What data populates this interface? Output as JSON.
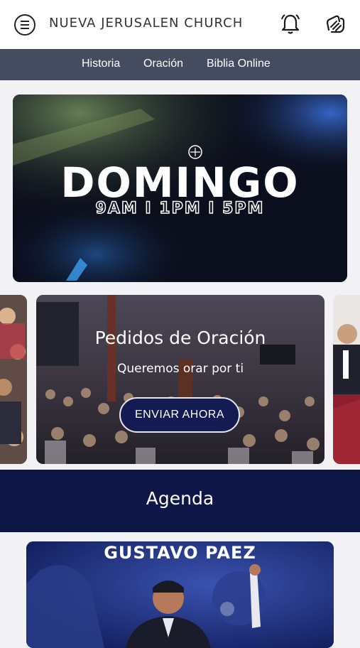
{
  "header": {
    "title": "NUEVA JERUSALEN CHURCH",
    "menu_icon": "hamburger-menu-icon",
    "bell_icon": "bell-icon",
    "hands_icon": "praying-hands-icon"
  },
  "nav": {
    "items": [
      {
        "label": "Historia"
      },
      {
        "label": "Oración"
      },
      {
        "label": "Biblia Online"
      }
    ]
  },
  "hero": {
    "title": "DOMINGO",
    "times": "9AM I 1PM I 5PM"
  },
  "prayer_card": {
    "title": "Pedidos de Oración",
    "subtitle": "Queremos orar por ti",
    "button_label": "ENVIAR AHORA"
  },
  "agenda": {
    "label": "Agenda"
  },
  "event_card": {
    "speaker": "GUSTAVO PAEZ"
  },
  "colors": {
    "navbar": "#454c60",
    "agenda_bg": "#0e1547",
    "button_bg": "#141a52"
  }
}
